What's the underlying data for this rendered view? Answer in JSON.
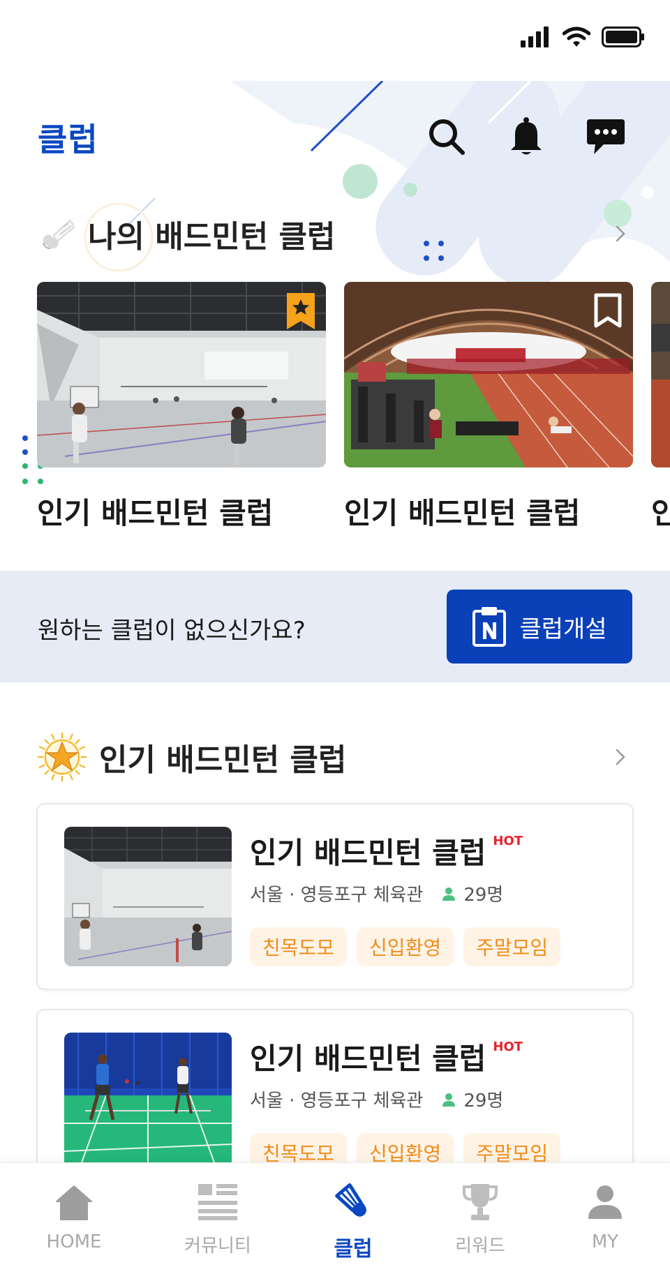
{
  "app": {
    "title": "클럽"
  },
  "header": {
    "search_icon": "search-icon",
    "notification_icon": "bell-icon",
    "message_icon": "chat-icon"
  },
  "my_clubs": {
    "title": "나의 배드민턴 클럽",
    "cards": [
      {
        "name": "인기 배드민턴 클럽",
        "bookmarked": true,
        "image": "indoor-gym"
      },
      {
        "name": "인기 배드민턴 클럽",
        "bookmarked": false,
        "image": "training-dome"
      },
      {
        "name": "인",
        "bookmarked": false,
        "image": "gym"
      }
    ]
  },
  "banner": {
    "text": "원하는 클럽이 없으신가요?",
    "button_label": "클럽개설"
  },
  "popular": {
    "title": "인기 배드민턴 클럽",
    "items": [
      {
        "title": "인기 배드민턴 클럽",
        "badge": "HOT",
        "location": "서울 · 영등포구 체육관",
        "members": "29명",
        "tags": [
          "친목도모",
          "신입환영",
          "주말모임"
        ],
        "image": "indoor-gym"
      },
      {
        "title": "인기 배드민턴 클럽",
        "badge": "HOT",
        "location": "서울 · 영등포구 체육관",
        "members": "29명",
        "tags": [
          "친목도모",
          "신입환영",
          "주말모임"
        ],
        "image": "badminton-court"
      }
    ]
  },
  "tabs": [
    {
      "label": "HOME",
      "icon": "home-icon",
      "active": false
    },
    {
      "label": "커뮤니티",
      "icon": "list-icon",
      "active": false
    },
    {
      "label": "클럽",
      "icon": "shuttlecock-icon",
      "active": true
    },
    {
      "label": "리워드",
      "icon": "trophy-icon",
      "active": false
    },
    {
      "label": "MY",
      "icon": "user-icon",
      "active": false
    }
  ],
  "colors": {
    "primary": "#0a47c2",
    "button": "#0a40b8",
    "tag_text": "#f08c1a",
    "tag_bg": "#fff3e6",
    "hot": "#e8232b",
    "banner_bg": "#e6ebf5"
  }
}
